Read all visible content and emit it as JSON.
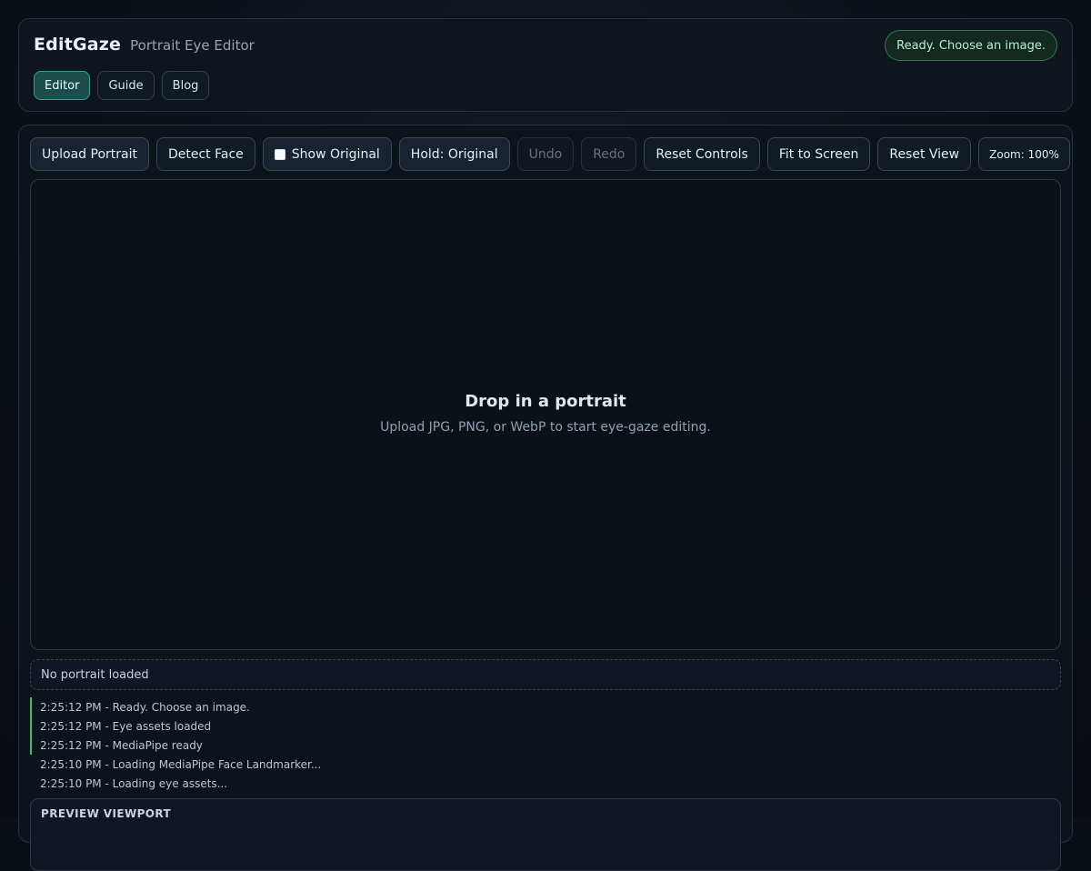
{
  "header": {
    "brand": "EditGaze",
    "subtitle": "Portrait Eye Editor",
    "status": "Ready. Choose an image.",
    "tabs": [
      {
        "label": "Editor"
      },
      {
        "label": "Guide"
      },
      {
        "label": "Blog"
      }
    ]
  },
  "toolbar": {
    "upload": "Upload Portrait",
    "detect": "Detect Face",
    "show_original": "Show Original",
    "hold_original": "Hold: Original",
    "undo": "Undo",
    "redo": "Redo",
    "reset_controls": "Reset Controls",
    "fit_screen": "Fit to Screen",
    "reset_view": "Reset View",
    "zoom": "Zoom: 100%"
  },
  "viewport": {
    "title": "Drop in a portrait",
    "description": "Upload JPG, PNG, or WebP to start eye-gaze editing."
  },
  "portrait_status": "No portrait loaded",
  "log": [
    "2:25:12 PM - Ready. Choose an image.",
    "2:25:12 PM - Eye assets loaded",
    "2:25:12 PM - MediaPipe ready",
    "2:25:10 PM - Loading MediaPipe Face Landmarker...",
    "2:25:10 PM - Loading eye assets..."
  ],
  "preview": {
    "label": "PREVIEW VIEWPORT"
  }
}
